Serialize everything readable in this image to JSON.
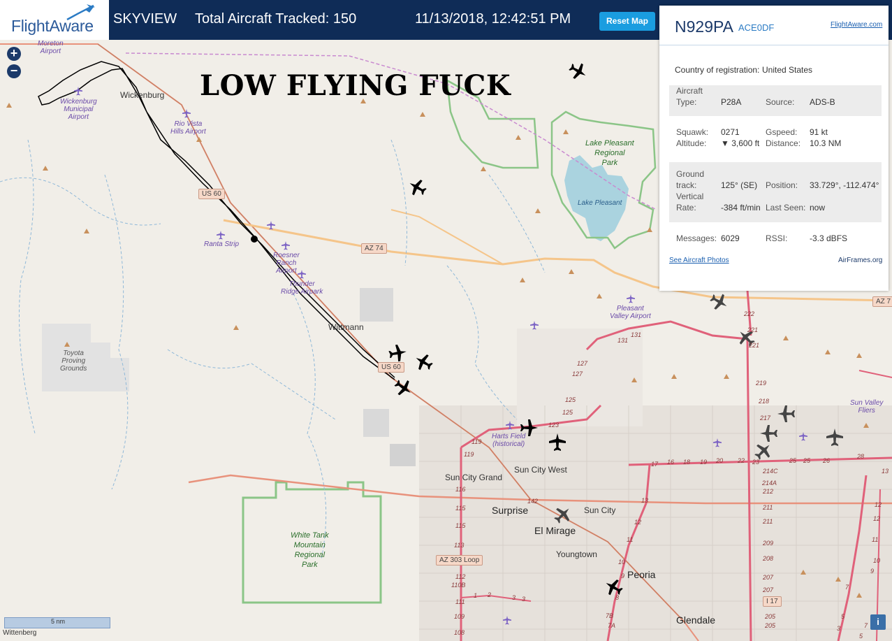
{
  "header": {
    "logo_text": "FlightAware",
    "app_name": "SKYVIEW",
    "total_tracked": "Total Aircraft Tracked: 150",
    "datetime": "11/13/2018, 12:42:51 PM",
    "reset_label": "Reset Map"
  },
  "map": {
    "overlay_caption": "LOW FLYING FUCK",
    "zoom_in": "+",
    "zoom_out": "−",
    "scale_label": "5 nm",
    "info_label": "i",
    "places": {
      "wickenburg": "Wickenburg",
      "wittmann": "Wittmann",
      "surprise": "Surprise",
      "el_mirage": "El Mirage",
      "sun_city": "Sun City",
      "sun_city_west": "Sun City West",
      "sun_city_grand": "Sun City Grand",
      "youngtown": "Youngtown",
      "peoria": "Peoria",
      "glendale": "Glendale",
      "lake_pleasant": "Lake Pleasant",
      "wittenberg": "Wittenberg"
    },
    "airports": {
      "moreton": "Moreton\nAirport",
      "wickenburg_muni": "Wickenburg\nMunicipal\nAirport",
      "rio_vista": "Rio Vista\nHills Airport",
      "ranta": "Ranta Strip",
      "roesner": "Roesner\nRanch\nAirport",
      "thunder_ridge": "Thunder\nRidge Airpark",
      "harts_field": "Harts Field\n(historical)",
      "pleasant_valley": "Pleasant\nValley Airport",
      "sun_valley": "Sun Valley\nFliers",
      "toyota": "Toyota\nProving\nGrounds"
    },
    "parks": {
      "lake_pleasant_park": "Lake Pleasant\nRegional\nPark",
      "white_tank": "White Tank\nMountain\nRegional\nPark"
    },
    "roads": {
      "us60_a": "US 60",
      "us60_b": "US 60",
      "az74": "AZ 74",
      "az303": "AZ 303 Loop",
      "i17": "I 17",
      "az7": "AZ 7"
    }
  },
  "panel": {
    "ident": "N929PA",
    "hex": "ACE0DF",
    "fa_link": "FlightAware.com",
    "country_label": "Country of registration:",
    "country_value": "United States",
    "aircraft_type_label": "Aircraft\nType:",
    "aircraft_type": "P28A",
    "source_label": "Source:",
    "source": "ADS-B",
    "squawk_label": "Squawk:",
    "squawk": "0271",
    "gspeed_label": "Gspeed:",
    "gspeed": "91 kt",
    "altitude_label": "Altitude:",
    "altitude": "▼ 3,600 ft",
    "distance_label": "Distance:",
    "distance": "10.3 NM",
    "track_label": "Ground\ntrack:",
    "track": "125° (SE)",
    "position_label": "Position:",
    "position": "33.729°, -112.474°",
    "vrate_label": "Vertical\nRate:",
    "vrate": "-384 ft/min",
    "lastseen_label": "Last Seen:",
    "lastseen": "now",
    "messages_label": "Messages:",
    "messages": "6029",
    "rssi_label": "RSSI:",
    "rssi": "-3.3 dBFS",
    "photos_link": "See Aircraft Photos",
    "airframes_link": "AirFrames.org"
  }
}
